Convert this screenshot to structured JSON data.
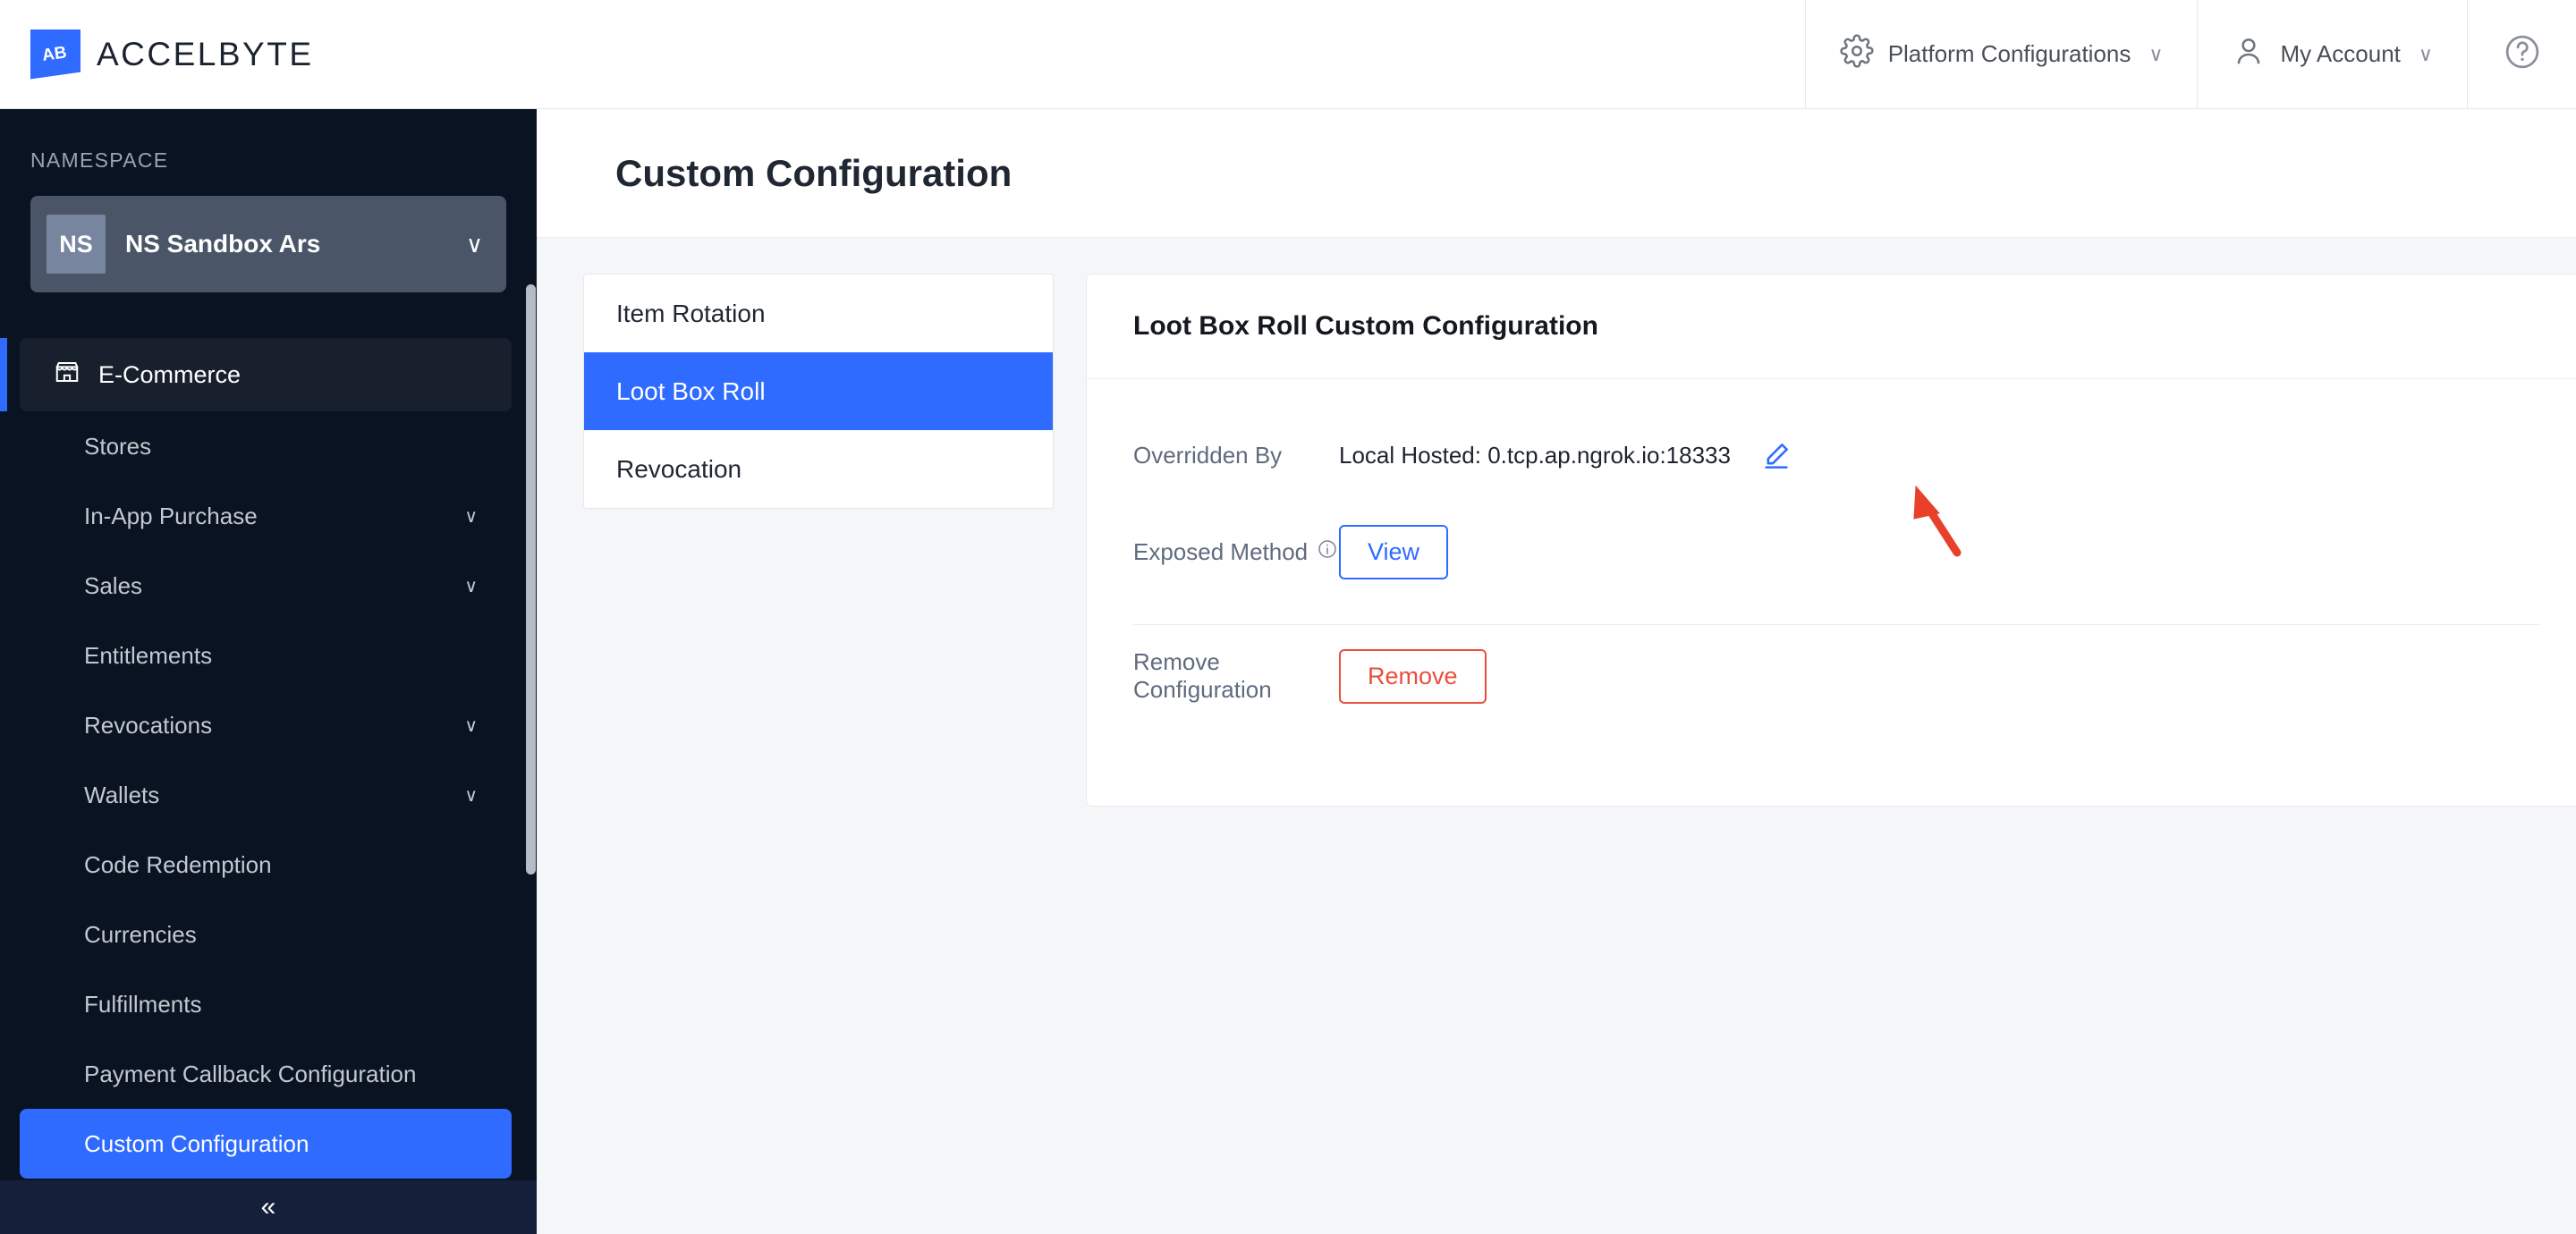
{
  "header": {
    "brand_name": "ACCELBYTE",
    "brand_mark_letters": "AB",
    "platform_config_label": "Platform Configurations",
    "account_label": "My Account",
    "caret_glyph": "∨",
    "gear_icon": "gear-icon",
    "user_icon": "user-icon",
    "help_icon": "help-circle-icon"
  },
  "sidebar": {
    "namespace_label": "NAMESPACE",
    "namespace_badge": "NS",
    "namespace_name": "NS Sandbox Ars",
    "namespace_caret": "∨",
    "group_label": "E-Commerce",
    "group_icon": "store-icon",
    "collapse_glyph": "«",
    "chevron_glyph": "∨",
    "items": [
      {
        "label": "Stores",
        "expandable": false,
        "active": false
      },
      {
        "label": "In-App Purchase",
        "expandable": true,
        "active": false
      },
      {
        "label": "Sales",
        "expandable": true,
        "active": false
      },
      {
        "label": "Entitlements",
        "expandable": false,
        "active": false
      },
      {
        "label": "Revocations",
        "expandable": true,
        "active": false
      },
      {
        "label": "Wallets",
        "expandable": true,
        "active": false
      },
      {
        "label": "Code Redemption",
        "expandable": false,
        "active": false
      },
      {
        "label": "Currencies",
        "expandable": false,
        "active": false
      },
      {
        "label": "Fulfillments",
        "expandable": false,
        "active": false
      },
      {
        "label": "Payment Callback Configuration",
        "expandable": false,
        "active": false
      },
      {
        "label": "Custom Configuration",
        "expandable": false,
        "active": true
      }
    ]
  },
  "page": {
    "title": "Custom Configuration"
  },
  "tabs": [
    {
      "label": "Item Rotation",
      "active": false
    },
    {
      "label": "Loot Box Roll",
      "active": true
    },
    {
      "label": "Revocation",
      "active": false
    }
  ],
  "card": {
    "title": "Loot Box Roll Custom Configuration",
    "overridden_by_label": "Overridden By",
    "overridden_by_value": "Local Hosted: 0.tcp.ap.ngrok.io:18333",
    "edit_icon": "pencil-edit-icon",
    "exposed_method_label": "Exposed Method",
    "exposed_method_info_icon": "info-circle-icon",
    "view_button": "View",
    "remove_config_label": "Remove Configuration",
    "remove_button": "Remove"
  },
  "annotation": {
    "arrow_icon": "red-arrow-pointer",
    "color": "#e8402a"
  },
  "colors": {
    "accent_blue": "#2f6bff",
    "sidebar_bg": "#0a1322",
    "danger_red": "#e8503a",
    "page_bg": "#f4f6f8"
  }
}
